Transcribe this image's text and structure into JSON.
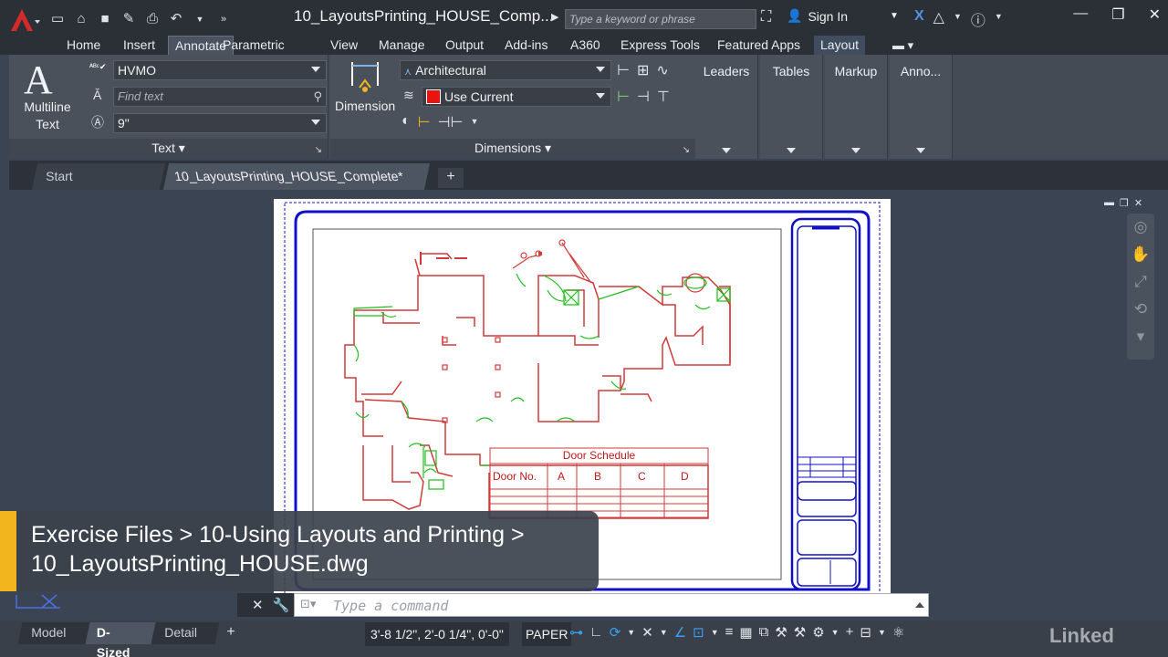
{
  "titlebar": {
    "doc_title": "10_LayoutsPrinting_HOUSE_Comp...",
    "search_placeholder": "Type a keyword or phrase",
    "sign_in": "Sign In"
  },
  "ribbon_tabs": [
    "Home",
    "Insert",
    "Annotate",
    "Parametric",
    "View",
    "Manage",
    "Output",
    "Add-ins",
    "A360",
    "Express Tools",
    "Featured Apps",
    "Layout"
  ],
  "active_tab": "Annotate",
  "text_panel": {
    "big_button": "Multiline Text",
    "style": "HVMO",
    "find_placeholder": "Find text",
    "height": "9\"",
    "title": "Text"
  },
  "dimension_panel": {
    "big_button": "Dimension",
    "dimstyle": "Architectural",
    "layer": "Use Current",
    "title": "Dimensions"
  },
  "collapsed_panels": [
    "Leaders",
    "Tables",
    "Markup",
    "Anno..."
  ],
  "file_tabs": {
    "start": "Start",
    "active": "10_LayoutsPrinting_HOUSE_Complete*"
  },
  "door_schedule": {
    "title": "Door Schedule",
    "headers": [
      "Door No.",
      "A",
      "B",
      "C",
      "D"
    ]
  },
  "command_line": {
    "placeholder": "Type a command"
  },
  "layout_tabs": [
    "Model",
    "D-Sized",
    "Detail"
  ],
  "active_layout": "D-Sized",
  "status": {
    "coords": "3'-8 1/2\", 2'-0 1/4\", 0'-0\"",
    "space": "PAPER"
  },
  "caption": {
    "line1": "Exercise Files > 10-Using Layouts and Printing >",
    "line2": "10_LayoutsPrinting_HOUSE.dwg"
  },
  "brand": "Linked",
  "colors": {
    "title_bg": "#2b2f36",
    "ribbon_bg": "#4a515b",
    "canvas_bg": "#3b4453",
    "accent_blue": "#1010c8",
    "wall_red": "#d23a3a",
    "door_green": "#1fbf1f",
    "caption_bar": "#f2b51d"
  }
}
